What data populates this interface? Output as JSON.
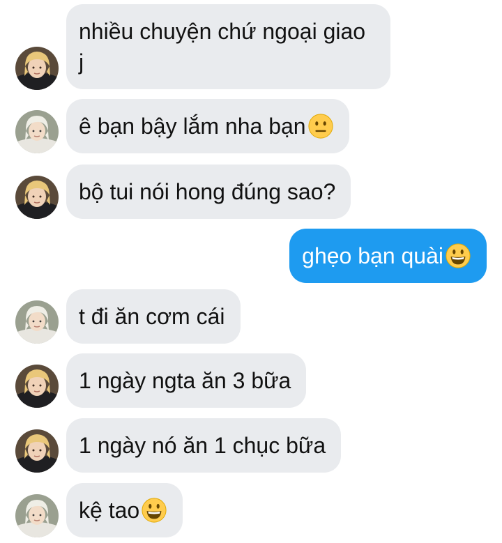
{
  "messages": [
    {
      "sender": "friend",
      "avatar": "blonde",
      "text": "nhiều chuyện chứ ngoại giao j",
      "emoji": null
    },
    {
      "sender": "friend",
      "avatar": "platinum",
      "text": "ê bạn bậy lắm nha bạn",
      "emoji": "neutral-face-emoji"
    },
    {
      "sender": "friend",
      "avatar": "blonde",
      "text": "bộ tui nói hong đúng sao?",
      "emoji": null
    },
    {
      "sender": "me",
      "avatar": null,
      "text": "ghẹo bạn quài",
      "emoji": "grinning-face-emoji"
    },
    {
      "sender": "friend",
      "avatar": "platinum",
      "text": "t đi ăn cơm cái",
      "emoji": null
    },
    {
      "sender": "friend",
      "avatar": "blonde",
      "text": "1 ngày ngta ăn 3 bữa",
      "emoji": null
    },
    {
      "sender": "friend",
      "avatar": "blonde",
      "text": "1 ngày nó ăn 1 chục bữa",
      "emoji": null
    },
    {
      "sender": "friend",
      "avatar": "platinum",
      "text": "kệ tao",
      "emoji": "grinning-face-emoji"
    }
  ],
  "colors": {
    "incoming_bubble": "#e9ebee",
    "outgoing_bubble": "#1e9bf0",
    "incoming_text": "#111111",
    "outgoing_text": "#ffffff"
  }
}
